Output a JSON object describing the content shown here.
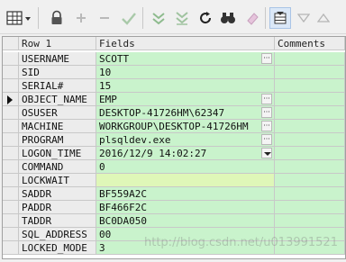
{
  "toolbar": {
    "buttons": [
      {
        "icon": "grid-layout-icon"
      },
      {
        "icon": "lock-icon"
      },
      {
        "icon": "plus-icon"
      },
      {
        "icon": "minus-icon"
      },
      {
        "icon": "check-icon"
      },
      {
        "icon": "double-down-icon"
      },
      {
        "icon": "double-down-alt-icon"
      },
      {
        "icon": "refresh-icon"
      },
      {
        "icon": "binoculars-icon"
      },
      {
        "icon": "eraser-icon"
      },
      {
        "icon": "grid-view-icon"
      },
      {
        "icon": "triangle-down-icon"
      },
      {
        "icon": "triangle-up-icon"
      }
    ]
  },
  "grid": {
    "headers": {
      "name": "Row 1",
      "value": "Fields",
      "comment": "Comments"
    },
    "rows": [
      {
        "name": "USERNAME",
        "value": "SCOTT",
        "ellipsis": true
      },
      {
        "name": "SID",
        "value": "10"
      },
      {
        "name": "SERIAL#",
        "value": "15"
      },
      {
        "name": "OBJECT_NAME",
        "value": "EMP",
        "ellipsis": true,
        "current": true
      },
      {
        "name": "OSUSER",
        "value": "DESKTOP-41726HM\\62347",
        "ellipsis": true
      },
      {
        "name": "MACHINE",
        "value": "WORKGROUP\\DESKTOP-41726HM",
        "ellipsis": true
      },
      {
        "name": "PROGRAM",
        "value": "plsqldev.exe",
        "ellipsis": true
      },
      {
        "name": "LOGON_TIME",
        "value": "2016/12/9 14:02:27",
        "dropdown": true
      },
      {
        "name": "COMMAND",
        "value": "0"
      },
      {
        "name": "LOCKWAIT",
        "value": "",
        "locked": true
      },
      {
        "name": "SADDR",
        "value": "BF559A2C"
      },
      {
        "name": "PADDR",
        "value": "BF466F2C"
      },
      {
        "name": "TADDR",
        "value": "BC0DA050"
      },
      {
        "name": "SQL_ADDRESS",
        "value": "00"
      },
      {
        "name": "LOCKED_MODE",
        "value": "3"
      }
    ]
  },
  "watermark": "http://blog.csdn.net/u013991521",
  "colors": {
    "cell_green": "#c9f3cc",
    "lockwait_green": "#dff7b8",
    "header_gray": "#ececec"
  }
}
